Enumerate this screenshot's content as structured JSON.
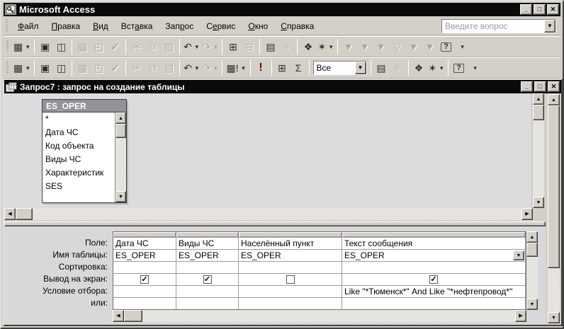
{
  "app": {
    "title": "Microsoft Access"
  },
  "icons": {
    "minimize": "_",
    "maximize": "□",
    "close": "✕",
    "dropdown": "▼",
    "scroll_up": "▲",
    "scroll_down": "▼",
    "scroll_left": "◀",
    "scroll_right": "▶",
    "check": "✓"
  },
  "menu_bar": {
    "items": [
      {
        "name": "file",
        "label": "Файл",
        "u": 0
      },
      {
        "name": "edit",
        "label": "Правка",
        "u": 0
      },
      {
        "name": "view",
        "label": "Вид",
        "u": 0
      },
      {
        "name": "insert",
        "label": "Вставка",
        "u": 3
      },
      {
        "name": "query",
        "label": "Запрос",
        "u": 3
      },
      {
        "name": "tools",
        "label": "Сервис",
        "u": 1
      },
      {
        "name": "window",
        "label": "Окно",
        "u": 0
      },
      {
        "name": "help",
        "label": "Справка",
        "u": 0
      }
    ],
    "question_placeholder": "Введите вопрос"
  },
  "toolbars": {
    "standard": [
      {
        "t": "btn",
        "name": "view-button",
        "glyph": "▦",
        "dd": true
      },
      {
        "t": "sep"
      },
      {
        "t": "btn",
        "name": "save-button",
        "glyph": "▣"
      },
      {
        "t": "btn",
        "name": "file-search-button",
        "glyph": "◫"
      },
      {
        "t": "sep"
      },
      {
        "t": "btn",
        "name": "print-button",
        "glyph": "▧",
        "dis": true
      },
      {
        "t": "btn",
        "name": "print-preview-button",
        "glyph": "◰",
        "dis": true
      },
      {
        "t": "btn",
        "name": "spelling-button",
        "glyph": "✔",
        "dis": true
      },
      {
        "t": "sep"
      },
      {
        "t": "btn",
        "name": "cut-button",
        "glyph": "✂",
        "dis": true
      },
      {
        "t": "btn",
        "name": "copy-button",
        "glyph": "⧉",
        "dis": true
      },
      {
        "t": "btn",
        "name": "paste-button",
        "glyph": "▨",
        "dis": true
      },
      {
        "t": "sep"
      },
      {
        "t": "btn",
        "name": "undo-button",
        "glyph": "↶",
        "dd": true
      },
      {
        "t": "btn",
        "name": "redo-button",
        "glyph": "↷",
        "dd": true,
        "dis": true
      },
      {
        "t": "sep"
      },
      {
        "t": "btn",
        "name": "insert-rows-button",
        "glyph": "⊞"
      },
      {
        "t": "btn",
        "name": "delete-rows-button",
        "glyph": "⊟",
        "dis": true
      },
      {
        "t": "sep"
      },
      {
        "t": "btn",
        "name": "properties-button",
        "glyph": "▤"
      },
      {
        "t": "btn",
        "name": "build-button",
        "glyph": "✧",
        "dis": true
      },
      {
        "t": "sep"
      },
      {
        "t": "btn",
        "name": "database-window-button",
        "glyph": "❖"
      },
      {
        "t": "btn",
        "name": "new-object-button",
        "glyph": "✶",
        "dd": true
      },
      {
        "t": "sep"
      },
      {
        "t": "btn",
        "name": "filter-by-selection-button",
        "glyph": "▼",
        "dis": true
      },
      {
        "t": "btn",
        "name": "filter-by-form-button",
        "glyph": "▼",
        "dis": true
      },
      {
        "t": "btn",
        "name": "filter-excluding-button",
        "glyph": "▼",
        "dis": true
      },
      {
        "t": "btn",
        "name": "apply-filter-button",
        "glyph": "▽",
        "dis": true
      },
      {
        "t": "btn",
        "name": "advanced-filter-button",
        "glyph": "▼",
        "dis": true
      },
      {
        "t": "btn",
        "name": "remove-filter-button",
        "glyph": "▼",
        "dis": true
      },
      {
        "t": "btn",
        "name": "help-button",
        "glyph": "?",
        "cls": "help"
      },
      {
        "t": "btn",
        "name": "toolbar-options-button",
        "glyph": "▾",
        "cls": "small"
      }
    ],
    "query_design": [
      {
        "t": "btn",
        "name": "view-button",
        "glyph": "▦",
        "dd": true
      },
      {
        "t": "sep"
      },
      {
        "t": "btn",
        "name": "save-button",
        "glyph": "▣"
      },
      {
        "t": "btn",
        "name": "file-search-button",
        "glyph": "◫"
      },
      {
        "t": "sep"
      },
      {
        "t": "btn",
        "name": "print-button",
        "glyph": "▧",
        "dis": true
      },
      {
        "t": "btn",
        "name": "print-preview-button",
        "glyph": "◰",
        "dis": true
      },
      {
        "t": "btn",
        "name": "spelling-button",
        "glyph": "✔",
        "dis": true
      },
      {
        "t": "sep"
      },
      {
        "t": "btn",
        "name": "cut-button",
        "glyph": "✂",
        "dis": true
      },
      {
        "t": "btn",
        "name": "copy-button",
        "glyph": "⧉",
        "dis": true
      },
      {
        "t": "btn",
        "name": "paste-button",
        "glyph": "▨",
        "dis": true
      },
      {
        "t": "sep"
      },
      {
        "t": "btn",
        "name": "undo-button",
        "glyph": "↶",
        "dd": true
      },
      {
        "t": "btn",
        "name": "redo-button",
        "glyph": "↷",
        "dd": true,
        "dis": true
      },
      {
        "t": "sep"
      },
      {
        "t": "btn",
        "name": "query-type-button",
        "glyph": "▦!",
        "dd": true
      },
      {
        "t": "sep"
      },
      {
        "t": "btn",
        "name": "run-button",
        "glyph": "!",
        "cls": "run"
      },
      {
        "t": "sep"
      },
      {
        "t": "btn",
        "name": "show-table-button",
        "glyph": "⊞"
      },
      {
        "t": "btn",
        "name": "totals-button",
        "glyph": "Σ"
      },
      {
        "t": "sep"
      },
      {
        "t": "combo",
        "name": "top-values-combo",
        "value": "Все"
      },
      {
        "t": "sep"
      },
      {
        "t": "btn",
        "name": "properties-button",
        "glyph": "▤"
      },
      {
        "t": "btn",
        "name": "build-button",
        "glyph": "✧",
        "dis": true
      },
      {
        "t": "sep"
      },
      {
        "t": "btn",
        "name": "database-window-button",
        "glyph": "❖"
      },
      {
        "t": "btn",
        "name": "new-object-button",
        "glyph": "✶",
        "dd": true
      },
      {
        "t": "sep"
      },
      {
        "t": "btn",
        "name": "help-button",
        "glyph": "?",
        "cls": "help"
      },
      {
        "t": "btn",
        "name": "toolbar-options-button",
        "glyph": "▾",
        "cls": "small"
      }
    ]
  },
  "doc": {
    "title": "Запрос7 : запрос на создание таблицы",
    "field_list": {
      "title": "ES_OPER",
      "items": [
        "*",
        "Дата ЧС",
        "Код объекта",
        "Виды ЧС",
        "Характеристик",
        "SES"
      ]
    },
    "grid": {
      "row_labels": [
        "Поле:",
        "Имя таблицы:",
        "Сортировка:",
        "Вывод на экран:",
        "Условие отбора:",
        "или:"
      ],
      "columns": [
        {
          "field": "Дата ЧС",
          "table": "ES_OPER",
          "sort": "",
          "show": true,
          "criteria": "",
          "or": ""
        },
        {
          "field": "Виды ЧС",
          "table": "ES_OPER",
          "sort": "",
          "show": true,
          "criteria": "",
          "or": ""
        },
        {
          "field": "Населённый пункт",
          "table": "ES_OPER",
          "sort": "",
          "show": false,
          "criteria": "",
          "or": ""
        },
        {
          "field": "Текст сообщения",
          "table": "ES_OPER",
          "sort": "",
          "show": true,
          "criteria": "Like \"*Тюменск*\" And Like \"*нефтепровод*\"",
          "or": "",
          "has_dropdown": true
        }
      ]
    }
  },
  "colors": {
    "chrome": "#d4d0c8",
    "titlebar": "#0a0a0a",
    "pane": "#dcdcde",
    "field_list_title": "#92929a"
  }
}
